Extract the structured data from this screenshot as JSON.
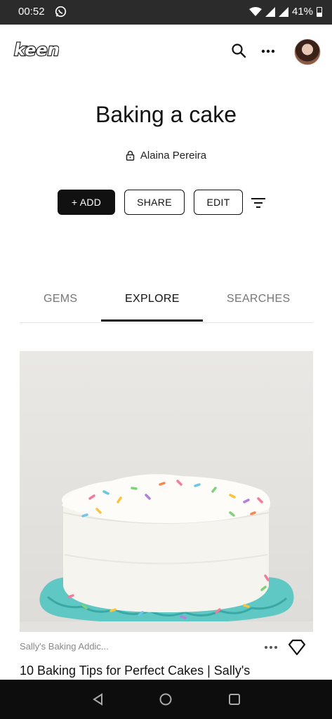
{
  "status_bar": {
    "time": "00:52",
    "battery": "41%"
  },
  "header": {
    "logo": "keen"
  },
  "collection": {
    "title": "Baking a cake",
    "owner": "Alaina Pereira"
  },
  "actions": {
    "add": "+ ADD",
    "share": "SHARE",
    "edit": "EDIT"
  },
  "tabs": [
    {
      "label": "GEMS"
    },
    {
      "label": "EXPLORE",
      "active": true
    },
    {
      "label": "SEARCHES"
    }
  ],
  "card": {
    "source": "Sally's Baking Addic...",
    "title": "10 Baking Tips for Perfect Cakes | Sally's"
  },
  "colors": {
    "accent": "#111111",
    "plate": "#5fc7c4",
    "frosting": "#f6f4ef"
  }
}
